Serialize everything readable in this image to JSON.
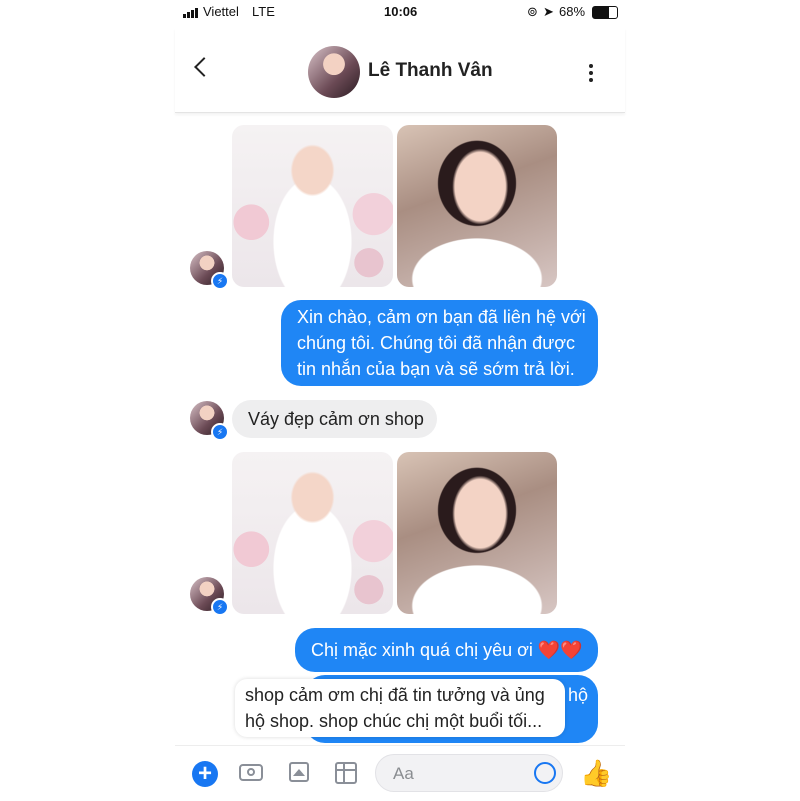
{
  "status_bar": {
    "carrier": "Viettel",
    "network": "LTE",
    "time": "10:06",
    "battery": "68%",
    "icons": [
      "signal-icon",
      "lock-rotation-icon",
      "location-icon",
      "battery-icon"
    ]
  },
  "header": {
    "contact_name": "Lê Thanh Vân",
    "icons": [
      "back-chevron-icon",
      "more-options-icon"
    ]
  },
  "messages": {
    "auto_reply_lines": [
      "Xin chào, cảm ơn bạn đã liên hệ với",
      "chúng tôi. Chúng tôi đã nhận được",
      "tin nhắn của bạn và sẽ sớm trả lời."
    ],
    "customer_message": "Váy đẹp cảm ơn shop",
    "compliment": "Chị mặc xinh quá chị yêu ơi ❤️❤️",
    "partial_hidden_text": "hộ"
  },
  "caption": {
    "lines": [
      "shop cảm ơm chị đã tin tưởng và ủng",
      "hộ shop. shop chúc chị một buổi tối..."
    ]
  },
  "composer": {
    "placeholder": "Aa",
    "icons": [
      "add-icon",
      "camera-icon",
      "gallery-icon",
      "sticker-icon",
      "emoji-icon",
      "like-icon"
    ]
  },
  "colors": {
    "messenger_blue": "#1f86f5",
    "incoming_bubble": "#eeeeef"
  }
}
